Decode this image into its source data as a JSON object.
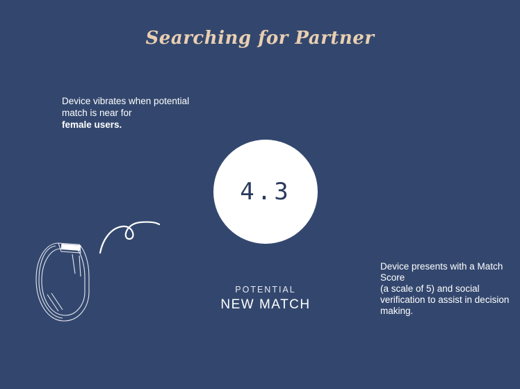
{
  "title": "Searching for Partner",
  "left_note": {
    "line1": "Device vibrates when potential match is near for",
    "emphasis": "female users."
  },
  "score": "4.3",
  "match_caption": {
    "eyebrow": "POTENTIAL",
    "headline": "NEW MATCH"
  },
  "right_note": {
    "line1": "Device presents with a Match Score",
    "line2": "(a scale of 5) and social verification to assist in decision making."
  },
  "icons": [
    "fitness-band-icon",
    "vibration-squiggle-icon"
  ],
  "colors": {
    "background": "#33476e",
    "title": "#e9cfb1",
    "circle": "#ffffff",
    "score_text": "#2a3a5e",
    "text": "#ffffff"
  }
}
